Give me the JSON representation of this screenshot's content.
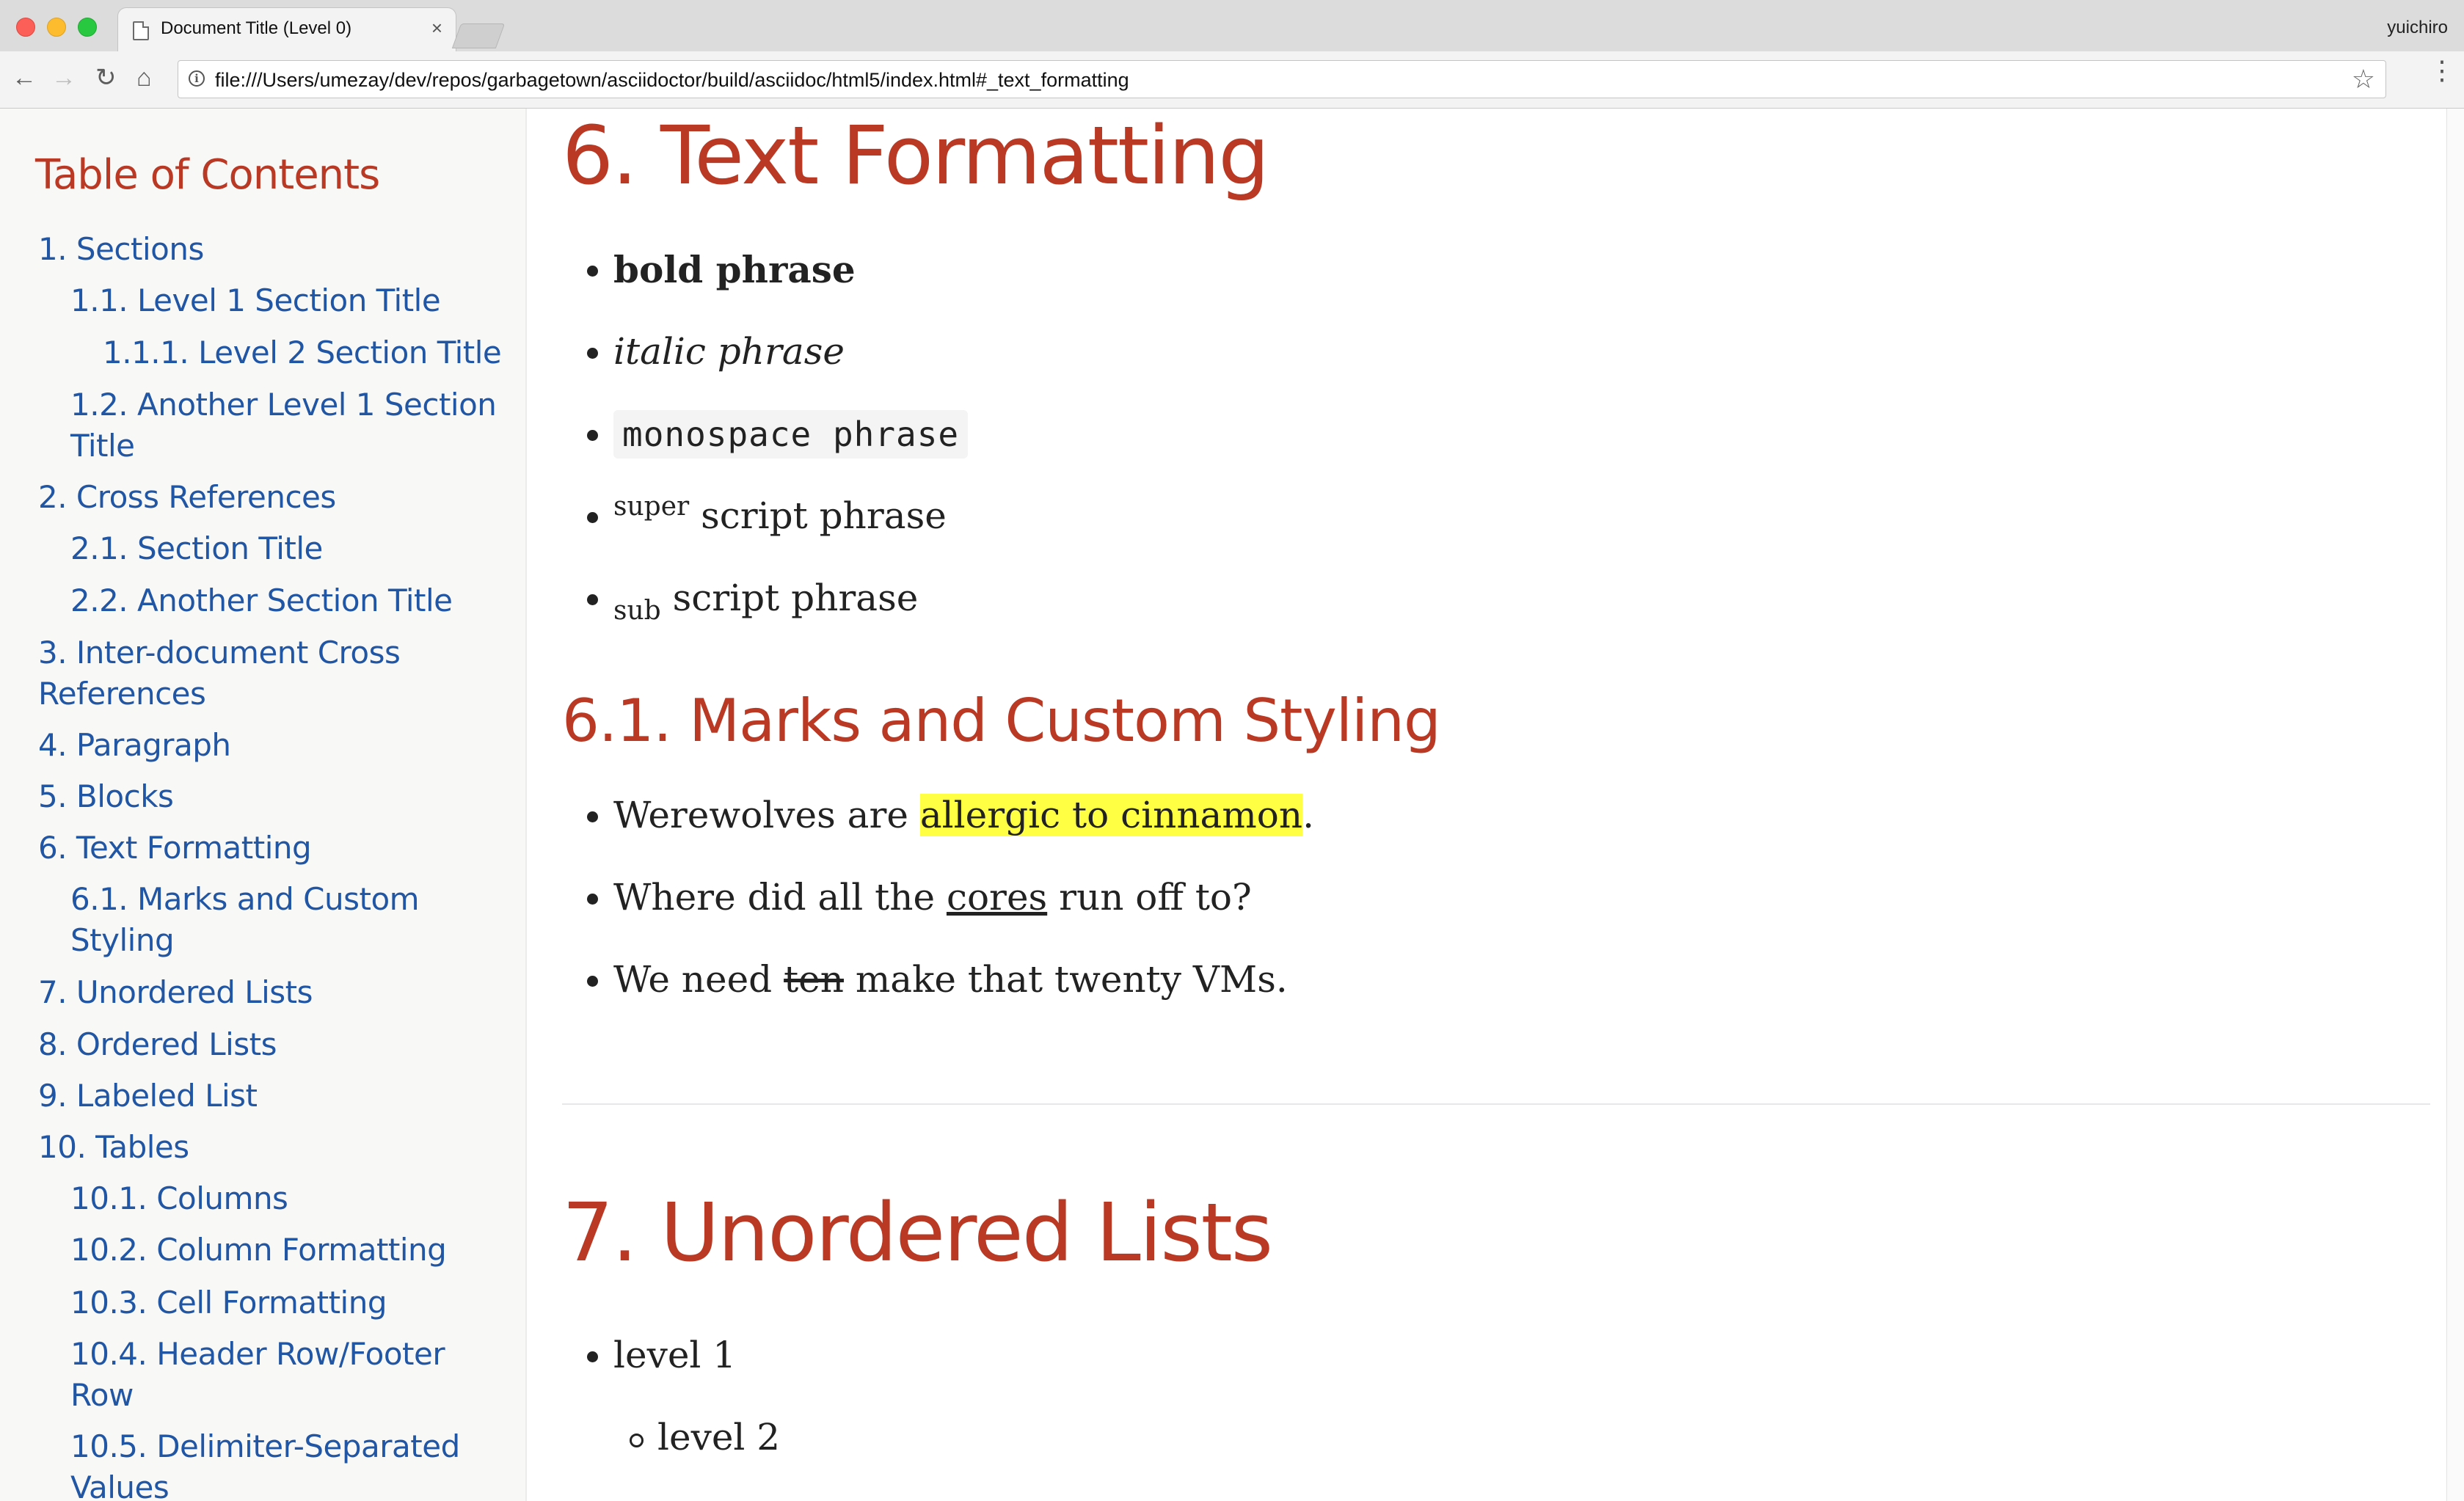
{
  "browser": {
    "tab_title": "Document Title (Level 0)",
    "tab_close": "×",
    "profile_name": "yuichiro",
    "url": "file:///Users/umezay/dev/repos/garbagetown/asciidoctor/build/asciidoc/html5/index.html#_text_formatting",
    "back": "←",
    "forward": "→",
    "reload": "↻",
    "home": "⌂",
    "star": "☆",
    "menu": "⋮",
    "info": "i"
  },
  "toc": {
    "title": "Table of Contents",
    "items": [
      {
        "label": "1. Sections",
        "level": 1
      },
      {
        "label": "1.1. Level 1 Section Title",
        "level": 2
      },
      {
        "label": "1.1.1. Level 2 Section Title",
        "level": 3
      },
      {
        "label": "1.2. Another Level 1 Section Title",
        "level": 2
      },
      {
        "label": "2. Cross References",
        "level": 1
      },
      {
        "label": "2.1. Section Title",
        "level": 2
      },
      {
        "label": "2.2. Another Section Title",
        "level": 2
      },
      {
        "label": "3. Inter-document Cross References",
        "level": 1
      },
      {
        "label": "4. Paragraph",
        "level": 1
      },
      {
        "label": "5. Blocks",
        "level": 1
      },
      {
        "label": "6. Text Formatting",
        "level": 1
      },
      {
        "label": "6.1. Marks and Custom Styling",
        "level": 2
      },
      {
        "label": "7. Unordered Lists",
        "level": 1
      },
      {
        "label": "8. Ordered Lists",
        "level": 1
      },
      {
        "label": "9. Labeled List",
        "level": 1
      },
      {
        "label": "10. Tables",
        "level": 1
      },
      {
        "label": "10.1. Columns",
        "level": 2
      },
      {
        "label": "10.2. Column Formatting",
        "level": 2
      },
      {
        "label": "10.3. Cell Formatting",
        "level": 2
      },
      {
        "label": "10.4. Header Row/Footer Row",
        "level": 2
      },
      {
        "label": "10.5. Delimiter-Separated Values",
        "level": 2
      }
    ]
  },
  "content": {
    "section6_title": "6. Text Formatting",
    "formatting": {
      "bold": "bold phrase",
      "italic": "italic phrase",
      "mono": "monospace phrase",
      "super_mark": "super",
      "super_rest": " script phrase",
      "sub_mark": "sub",
      "sub_rest": " script phrase"
    },
    "section61_title": "6.1. Marks and Custom Styling",
    "marks": {
      "line1_pre": "Werewolves are ",
      "line1_mark": "allergic to cinnamon",
      "line1_post": ".",
      "line2_pre": "Where did all the ",
      "line2_u": "cores",
      "line2_post": " run off to?",
      "line3_pre": "We need ",
      "line3_s": "ten",
      "line3_post": " make that twenty VMs."
    },
    "section7_title": "7. Unordered Lists",
    "list": {
      "level1": "level 1",
      "level2": "level 2"
    }
  },
  "colors": {
    "heading": "#ba3925",
    "link": "#2156a5",
    "highlight": "#ffff44",
    "sidebar_bg": "#f8f8f7"
  }
}
